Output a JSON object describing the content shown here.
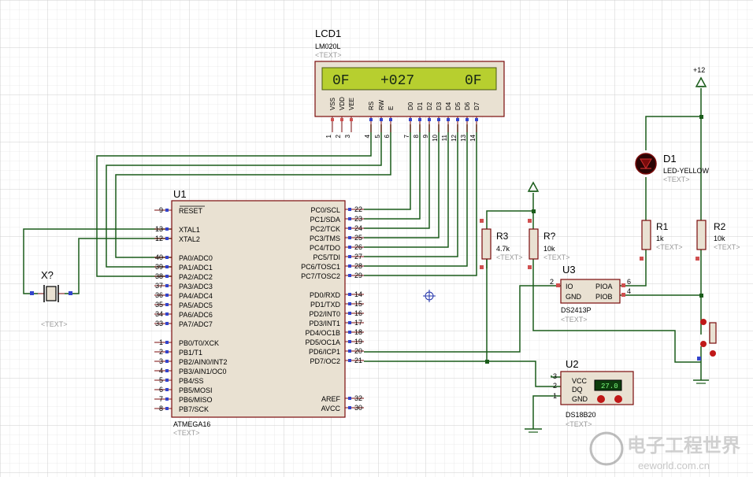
{
  "lcd": {
    "ref": "LCD1",
    "model": "LM020L",
    "text": "<TEXT>",
    "display": {
      "left": "0F",
      "mid": "+027",
      "right": "0F"
    },
    "pin_names": [
      "VSS",
      "VDD",
      "VEE",
      "RS",
      "RW",
      "E",
      "D0",
      "D1",
      "D2",
      "D3",
      "D4",
      "D5",
      "D6",
      "D7"
    ],
    "pin_numbers": [
      "1",
      "2",
      "3",
      "4",
      "5",
      "6",
      "7",
      "8",
      "9",
      "10",
      "11",
      "12",
      "13",
      "14"
    ]
  },
  "mcu": {
    "ref": "U1",
    "model": "ATMEGA16",
    "text": "<TEXT>",
    "left_pins": [
      {
        "num": "9",
        "name": "RESET"
      },
      {
        "num": "13",
        "name": "XTAL1"
      },
      {
        "num": "12",
        "name": "XTAL2"
      },
      {
        "num": "40",
        "name": "PA0/ADC0"
      },
      {
        "num": "39",
        "name": "PA1/ADC1"
      },
      {
        "num": "38",
        "name": "PA2/ADC2"
      },
      {
        "num": "37",
        "name": "PA3/ADC3"
      },
      {
        "num": "36",
        "name": "PA4/ADC4"
      },
      {
        "num": "35",
        "name": "PA5/ADC5"
      },
      {
        "num": "34",
        "name": "PA6/ADC6"
      },
      {
        "num": "33",
        "name": "PA7/ADC7"
      },
      {
        "num": "1",
        "name": "PB0/T0/XCK"
      },
      {
        "num": "2",
        "name": "PB1/T1"
      },
      {
        "num": "3",
        "name": "PB2/AIN0/INT2"
      },
      {
        "num": "4",
        "name": "PB3/AIN1/OC0"
      },
      {
        "num": "5",
        "name": "PB4/SS"
      },
      {
        "num": "6",
        "name": "PB5/MOSI"
      },
      {
        "num": "7",
        "name": "PB6/MISO"
      },
      {
        "num": "8",
        "name": "PB7/SCK"
      }
    ],
    "right_pins": [
      {
        "num": "22",
        "name": "PC0/SCL"
      },
      {
        "num": "23",
        "name": "PC1/SDA"
      },
      {
        "num": "24",
        "name": "PC2/TCK"
      },
      {
        "num": "25",
        "name": "PC3/TMS"
      },
      {
        "num": "26",
        "name": "PC4/TDO"
      },
      {
        "num": "27",
        "name": "PC5/TDI"
      },
      {
        "num": "28",
        "name": "PC6/TOSC1"
      },
      {
        "num": "29",
        "name": "PC7/TOSC2"
      },
      {
        "num": "14",
        "name": "PD0/RXD"
      },
      {
        "num": "15",
        "name": "PD1/TXD"
      },
      {
        "num": "16",
        "name": "PD2/INT0"
      },
      {
        "num": "17",
        "name": "PD3/INT1"
      },
      {
        "num": "18",
        "name": "PD4/OC1B"
      },
      {
        "num": "19",
        "name": "PD5/OC1A"
      },
      {
        "num": "20",
        "name": "PD6/ICP1"
      },
      {
        "num": "21",
        "name": "PD7/OC2"
      },
      {
        "num": "32",
        "name": "AREF"
      },
      {
        "num": "30",
        "name": "AVCC"
      }
    ]
  },
  "crystal": {
    "ref": "X?",
    "text": "<TEXT>"
  },
  "r3": {
    "ref": "R3",
    "value": "4.7k",
    "text": "<TEXT>"
  },
  "rq": {
    "ref": "R?",
    "value": "10k",
    "text": "<TEXT>"
  },
  "r1": {
    "ref": "R1",
    "value": "1k",
    "text": "<TEXT>"
  },
  "r2": {
    "ref": "R2",
    "value": "10k",
    "text": "<TEXT>"
  },
  "led": {
    "ref": "D1",
    "model": "LED-YELLOW",
    "text": "<TEXT>"
  },
  "u3": {
    "ref": "U3",
    "model": "DS2413P",
    "text": "<TEXT>",
    "pins": {
      "io": "IO",
      "gnd": "GND",
      "pioa": "PIOA",
      "piob": "PIOB"
    },
    "pin_numbers": {
      "io": "2",
      "pioa": "6",
      "piob": "4"
    }
  },
  "u2": {
    "ref": "U2",
    "model": "DS18B20",
    "text": "<TEXT>",
    "reading": "27.0",
    "pins": {
      "vcc": "VCC",
      "dq": "DQ",
      "gnd": "GND"
    },
    "pin_numbers": {
      "vcc": "3",
      "dq": "2",
      "gnd": "1"
    }
  },
  "power": {
    "label": "+12"
  },
  "watermark": {
    "text": "电子工程世界",
    "url": "eeworld.com.cn"
  },
  "colors": {
    "wire": "#1a5c1a",
    "part_fill": "#e9e1d2",
    "part_stroke": "#7a0b0b",
    "lcd_screen": "#b7cf2f",
    "grid": "#dcdcdc"
  }
}
